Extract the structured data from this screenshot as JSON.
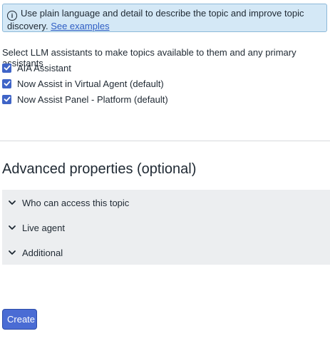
{
  "banner": {
    "text": "Use plain language and detail to describe the topic and improve topic discovery.",
    "link_label": "See examples"
  },
  "assistants": {
    "instruction": "Select LLM assistants to make topics available to them and any primary assistants",
    "items": [
      {
        "label": "AIA Assistant",
        "checked": true
      },
      {
        "label": "Now Assist in Virtual Agent (default)",
        "checked": true
      },
      {
        "label": "Now Assist Panel - Platform (default)",
        "checked": true
      }
    ]
  },
  "advanced": {
    "heading": "Advanced properties (optional)",
    "sections": [
      {
        "label": "Who can access this topic",
        "expanded": false
      },
      {
        "label": "Live agent",
        "expanded": false
      },
      {
        "label": "Additional",
        "expanded": false
      }
    ]
  },
  "actions": {
    "create_label": "Create"
  },
  "colors": {
    "banner_bg": "#d4e8f6",
    "checkbox": "#3f64c7",
    "primary_button": "#4a6cd4",
    "link": "#2e5dc4"
  }
}
